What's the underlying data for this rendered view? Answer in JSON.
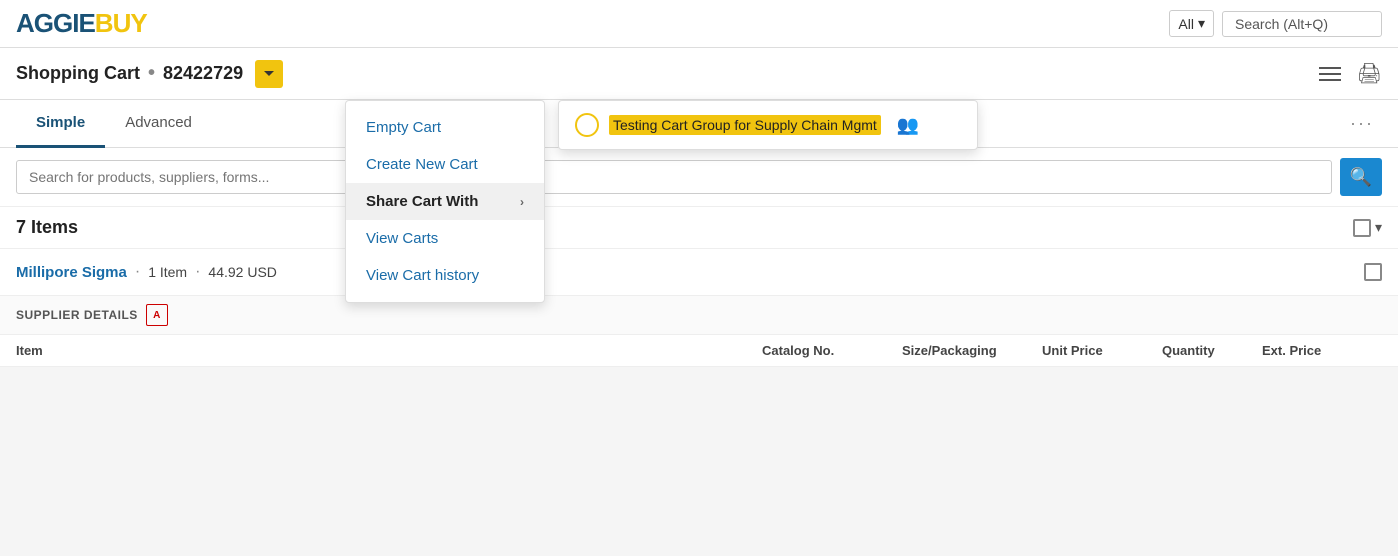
{
  "header": {
    "logo_aggie": "AGGIE",
    "logo_buy": "BUY",
    "search_dropdown_label": "All",
    "search_placeholder": "Search (Alt+Q)"
  },
  "cart_bar": {
    "title": "Shopping Cart",
    "dot": "•",
    "cart_number": "82422729"
  },
  "tabs": {
    "items": [
      {
        "label": "Simple",
        "active": true
      },
      {
        "label": "Advanced",
        "active": false
      }
    ],
    "more_label": "···"
  },
  "search": {
    "placeholder": "Search for products, suppliers, forms...",
    "search_icon": "🔍"
  },
  "cart_group": {
    "group_name": "Testing Cart Group for Supply Chain Mgmt"
  },
  "dropdown_menu": {
    "items": [
      {
        "label": "Empty Cart",
        "has_submenu": false
      },
      {
        "label": "Create New Cart",
        "has_submenu": false
      },
      {
        "label": "Share Cart With",
        "has_submenu": true,
        "highlighted": true
      },
      {
        "label": "View Carts",
        "has_submenu": false
      },
      {
        "label": "View Cart history",
        "has_submenu": false
      }
    ]
  },
  "items_section": {
    "count_label": "7 Items"
  },
  "supplier": {
    "name": "Millipore Sigma",
    "dot": "·",
    "item_count": "1 Item",
    "price": "44.92 USD"
  },
  "supplier_details": {
    "label": "SUPPLIER DETAILS"
  },
  "table": {
    "columns": [
      "Item",
      "Catalog No.",
      "Size/Packaging",
      "Unit Price",
      "Quantity",
      "Ext. Price"
    ]
  }
}
